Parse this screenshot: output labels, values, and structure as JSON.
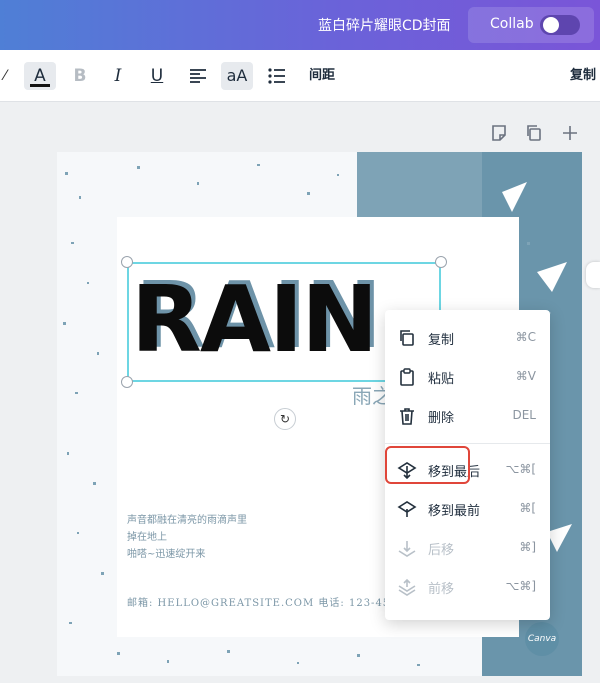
{
  "header": {
    "doc_title": "蓝白碎片耀眼CD封面",
    "collab_label": "Collab"
  },
  "toolbar": {
    "text_color_glyph": "A",
    "bold_glyph": "B",
    "italic_glyph": "I",
    "underline_glyph": "U",
    "case_glyph": "aA",
    "spacing_label": "间距",
    "copy_label": "复制"
  },
  "design": {
    "headline": "RAIN",
    "subtitle": "雨之",
    "poem": [
      "声音都融在清亮的雨滴声里",
      "掉在地上",
      "啪嗒~迅速绽开来"
    ],
    "footer": "邮箱: HELLO@GREATSITE.COM   电话: 123-456",
    "brand_badge": "Canva",
    "accent_color": "#6a95ab"
  },
  "context_menu": {
    "items": [
      {
        "label": "复制",
        "shortcut": "⌘C",
        "icon": "copy-icon",
        "enabled": true
      },
      {
        "label": "粘贴",
        "shortcut": "⌘V",
        "icon": "clipboard-icon",
        "enabled": true
      },
      {
        "label": "删除",
        "shortcut": "DEL",
        "icon": "trash-icon",
        "enabled": true
      },
      {
        "label": "移到最后",
        "shortcut": "⌥⌘[",
        "icon": "send-to-back-icon",
        "enabled": true
      },
      {
        "label": "移到最前",
        "shortcut": "⌘[",
        "icon": "bring-to-front-icon",
        "enabled": true
      },
      {
        "label": "后移",
        "shortcut": "⌘]",
        "icon": "send-backward-icon",
        "enabled": false
      },
      {
        "label": "前移",
        "shortcut": "⌥⌘]",
        "icon": "bring-forward-icon",
        "enabled": false
      }
    ],
    "highlight_color": "#e0463a"
  }
}
